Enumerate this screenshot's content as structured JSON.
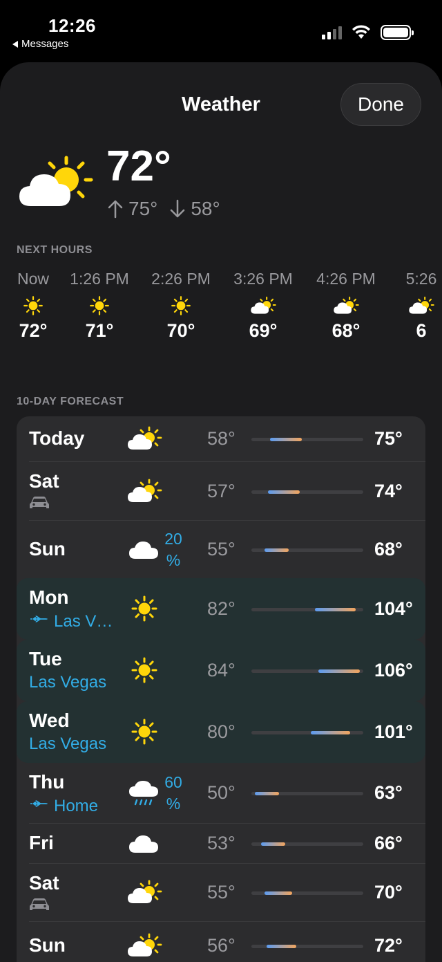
{
  "status": {
    "time": "12:26",
    "back_label": "Messages"
  },
  "sheet": {
    "title": "Weather",
    "done_label": "Done"
  },
  "current": {
    "icon": "partly-sunny-icon",
    "temp": "72°",
    "high": "75°",
    "low": "58°"
  },
  "next_hours": {
    "label": "NEXT HOURS",
    "items": [
      {
        "time": "Now",
        "icon": "sun-icon",
        "temp": "72°"
      },
      {
        "time": "1:26 PM",
        "icon": "sun-icon",
        "temp": "71°"
      },
      {
        "time": "2:26 PM",
        "icon": "sun-icon",
        "temp": "70°"
      },
      {
        "time": "3:26 PM",
        "icon": "partly-sunny-icon",
        "temp": "69°"
      },
      {
        "time": "4:26 PM",
        "icon": "partly-sunny-icon",
        "temp": "68°"
      },
      {
        "time": "5:26",
        "icon": "partly-sunny-icon",
        "temp": "6"
      }
    ]
  },
  "forecast": {
    "label": "10-DAY FORECAST",
    "range_min": 48,
    "range_max": 108,
    "days": [
      {
        "day": "Today",
        "icon": "partly-sunny-icon",
        "low": "58°",
        "high": "75°",
        "low_val": 58,
        "high_val": 75
      },
      {
        "day": "Sat",
        "sub_icon": "car-icon",
        "icon": "partly-sunny-icon",
        "low": "57°",
        "high": "74°",
        "low_val": 57,
        "high_val": 74
      },
      {
        "day": "Sun",
        "icon": "cloud-icon",
        "precip_num": "20",
        "precip_pct": "%",
        "low": "55°",
        "high": "68°",
        "low_val": 55,
        "high_val": 68
      },
      {
        "day": "Mon",
        "sub_icon": "airplane-icon",
        "sub_text": "Las V…",
        "icon": "sun-icon",
        "low": "82°",
        "high": "104°",
        "low_val": 82,
        "high_val": 104,
        "travel": true
      },
      {
        "day": "Tue",
        "sub_text": "Las Vegas",
        "icon": "sun-icon",
        "low": "84°",
        "high": "106°",
        "low_val": 84,
        "high_val": 106,
        "travel": true
      },
      {
        "day": "Wed",
        "sub_text": "Las Vegas",
        "icon": "sun-icon",
        "low": "80°",
        "high": "101°",
        "low_val": 80,
        "high_val": 101,
        "travel": true
      },
      {
        "day": "Thu",
        "sub_icon": "airplane-icon",
        "sub_text": "Home",
        "icon": "rain-icon",
        "precip_num": "60",
        "precip_pct": "%",
        "low": "50°",
        "high": "63°",
        "low_val": 50,
        "high_val": 63
      },
      {
        "day": "Fri",
        "icon": "cloud-icon",
        "low": "53°",
        "high": "66°",
        "low_val": 53,
        "high_val": 66
      },
      {
        "day": "Sat",
        "sub_icon": "car-icon",
        "icon": "partly-sunny-icon",
        "low": "55°",
        "high": "70°",
        "low_val": 55,
        "high_val": 70
      },
      {
        "day": "Sun",
        "icon": "partly-sunny-icon",
        "low": "56°",
        "high": "72°",
        "low_val": 56,
        "high_val": 72
      }
    ]
  },
  "colors": {
    "background": "#000000",
    "sheet": "#1c1c1e",
    "card": "#2c2c2e",
    "travel_row": "#233132",
    "accent_blue": "#32ade6",
    "sun_yellow": "#ffd60a",
    "bar_cool": "#5b9cf2",
    "bar_warm": "#f3a55d"
  }
}
